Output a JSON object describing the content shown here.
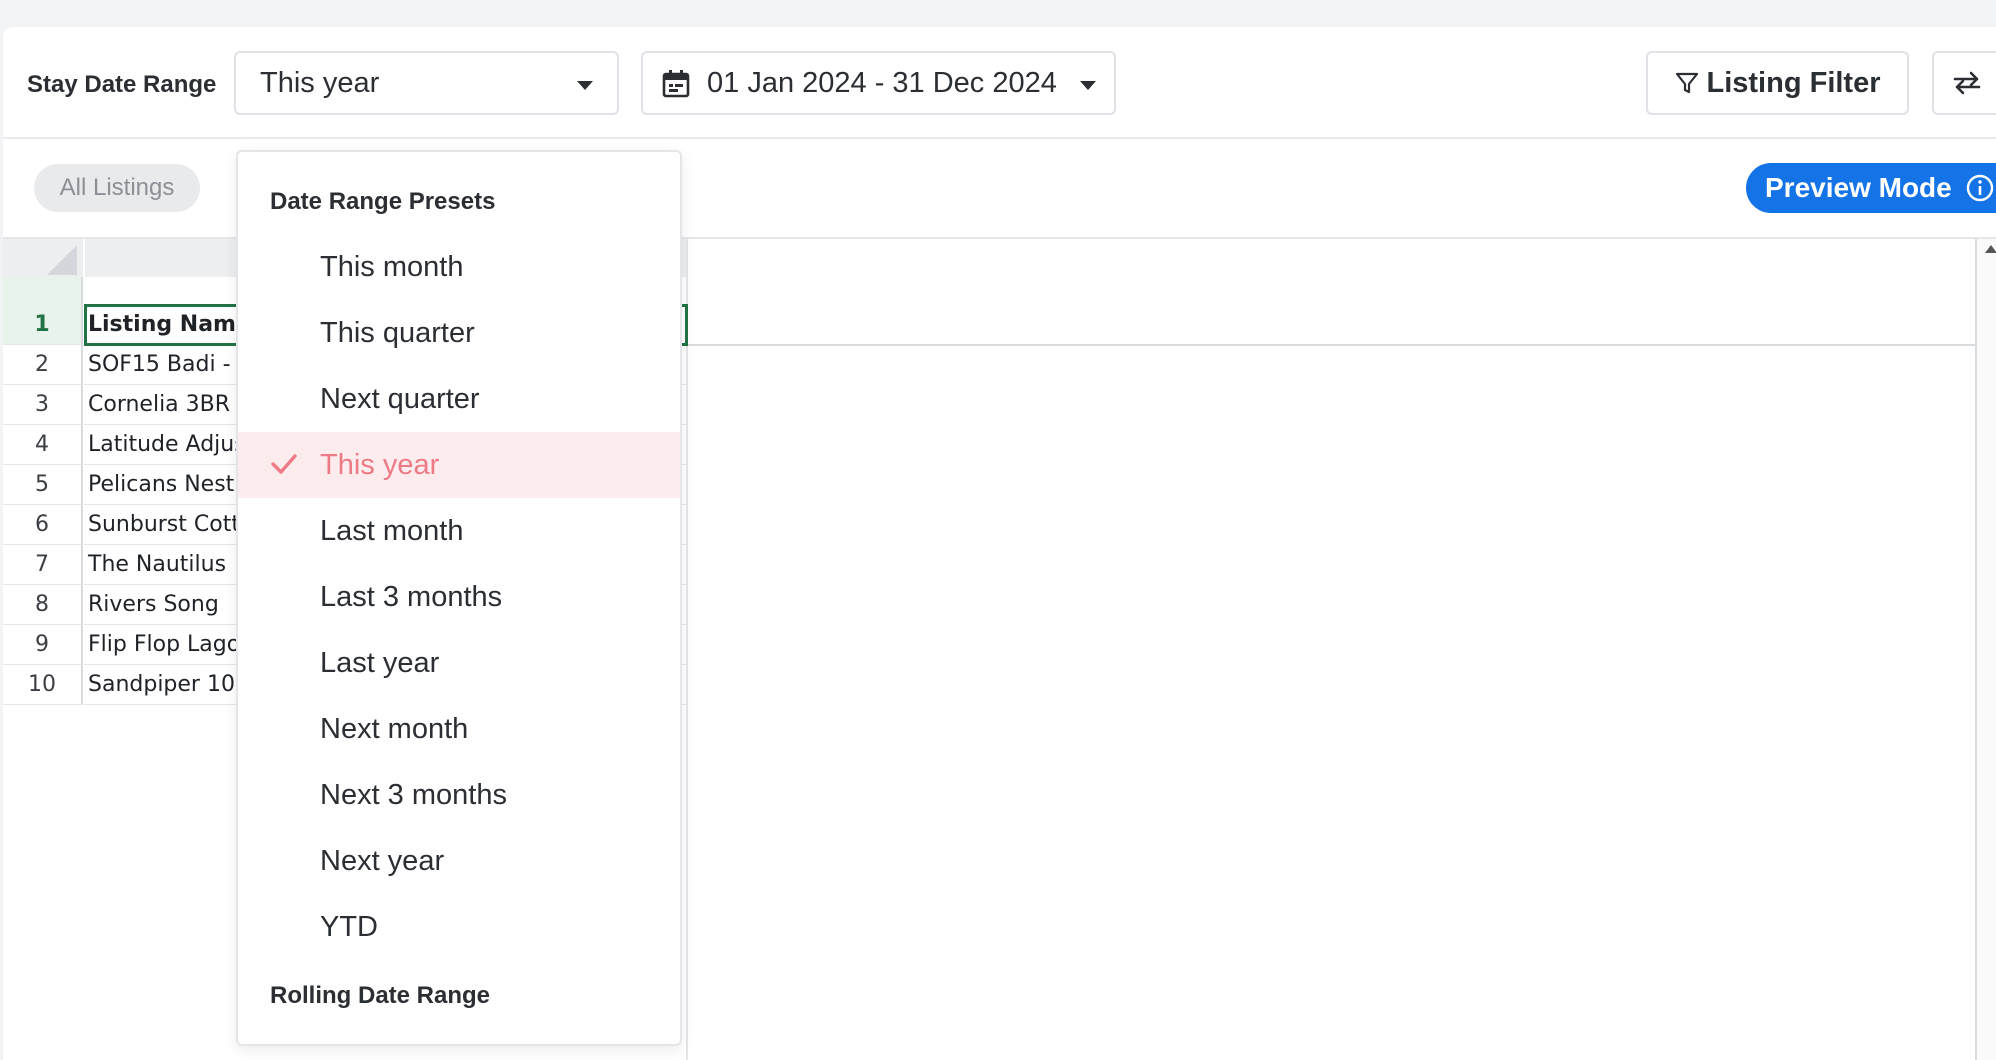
{
  "toolbar": {
    "stay_label": "Stay Date Range",
    "range_value": "This year",
    "date_value": "01 Jan 2024 - 31 Dec 2024",
    "listing_filter_label": "Listing Filter"
  },
  "filters": {
    "chip_label": "All Listings",
    "preview_label": "Preview Mode"
  },
  "grid": {
    "rows": [
      {
        "num": "1",
        "value": "Listing Name"
      },
      {
        "num": "2",
        "value": "SOF15 Badi -"
      },
      {
        "num": "3",
        "value": "Cornelia 3BR"
      },
      {
        "num": "4",
        "value": "Latitude Adjus"
      },
      {
        "num": "5",
        "value": "Pelicans Nest"
      },
      {
        "num": "6",
        "value": "Sunburst Cott"
      },
      {
        "num": "7",
        "value": "The Nautilus"
      },
      {
        "num": "8",
        "value": "Rivers Song"
      },
      {
        "num": "9",
        "value": "Flip Flop Lago"
      },
      {
        "num": "10",
        "value": "Sandpiper 10"
      }
    ]
  },
  "dropdown": {
    "presets_title": "Date Range Presets",
    "options": [
      {
        "label": "This month"
      },
      {
        "label": "This quarter"
      },
      {
        "label": "Next quarter"
      },
      {
        "label": "This year"
      },
      {
        "label": "Last month"
      },
      {
        "label": "Last 3 months"
      },
      {
        "label": "Last year"
      },
      {
        "label": "Next month"
      },
      {
        "label": "Next 3 months"
      },
      {
        "label": "Next year"
      },
      {
        "label": "YTD"
      }
    ],
    "rolling_title": "Rolling Date Range"
  },
  "colors": {
    "accent": "#1473e6",
    "selected_bg": "#fdecee",
    "selected_text": "#ee7a86",
    "sheet_green": "#217346"
  }
}
